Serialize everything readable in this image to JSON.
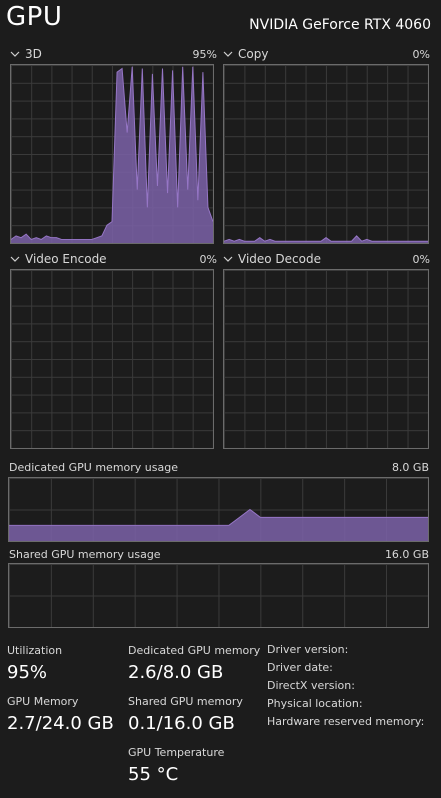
{
  "header": {
    "title": "GPU",
    "device": "NVIDIA GeForce RTX 4060"
  },
  "graphs": {
    "g3d": {
      "label": "3D",
      "percent": "95%",
      "series": [
        2,
        4,
        3,
        5,
        2,
        3,
        2,
        4,
        3,
        3,
        2,
        2,
        2,
        2,
        2,
        2,
        2,
        3,
        4,
        10,
        12,
        96,
        98,
        62,
        99,
        30,
        98,
        20,
        95,
        32,
        98,
        28,
        97,
        20,
        99,
        30,
        99,
        24,
        96,
        20,
        12
      ]
    },
    "copy": {
      "label": "Copy",
      "percent": "0%",
      "series": [
        1,
        2,
        1,
        2,
        1,
        1,
        1,
        3,
        1,
        2,
        1,
        1,
        1,
        1,
        1,
        1,
        1,
        1,
        1,
        1,
        3,
        1,
        1,
        1,
        1,
        1,
        4,
        1,
        2,
        1,
        1,
        1,
        1,
        1,
        1,
        1,
        1,
        1,
        1,
        1,
        1
      ]
    },
    "video_encode": {
      "label": "Video Encode",
      "percent": "0%"
    },
    "video_decode": {
      "label": "Video Decode",
      "percent": "0%"
    }
  },
  "memory": {
    "dedicated": {
      "label": "Dedicated GPU memory usage",
      "max": "8.0 GB",
      "series": [
        2,
        2,
        2,
        2,
        2,
        2,
        2,
        2,
        2,
        2,
        2,
        2,
        2,
        2,
        2,
        2,
        2,
        2,
        2,
        2,
        2,
        2,
        3,
        4,
        3,
        3,
        3,
        3,
        3,
        3,
        3,
        3,
        3,
        3,
        3,
        3,
        3,
        3,
        3,
        3,
        3
      ]
    },
    "shared": {
      "label": "Shared GPU memory usage",
      "max": "16.0 GB"
    }
  },
  "stats": {
    "utilization": {
      "label": "Utilization",
      "value": "95%"
    },
    "gpu_memory": {
      "label": "GPU Memory",
      "value": "2.7/24.0 GB"
    },
    "dedicated_memory": {
      "label": "Dedicated GPU memory",
      "value": "2.6/8.0 GB"
    },
    "shared_memory": {
      "label": "Shared GPU memory",
      "value": "0.1/16.0 GB"
    },
    "temperature": {
      "label": "GPU Temperature",
      "value": "55 °C"
    }
  },
  "info": {
    "driver_version": "Driver version:",
    "driver_date": "Driver date:",
    "directx_version": "DirectX version:",
    "physical_location": "Physical location:",
    "hw_reserved": "Hardware reserved memory:"
  },
  "colors": {
    "accent": "#9676c6",
    "fill": "#7b61a8",
    "grid": "#3a3a3a",
    "border": "#6b6b6b"
  }
}
